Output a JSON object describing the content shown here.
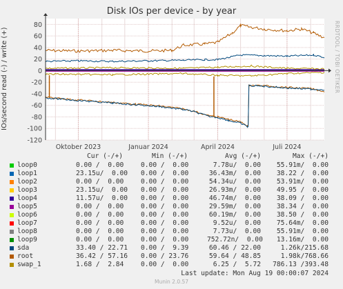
{
  "title": "Disk IOs per device - by year",
  "side_label": "RRDTOOL / TOBI OETIKER",
  "footer": {
    "last_update": "Last update: Mon Aug 19 00:00:07 2024",
    "version": "Munin 2.0.57"
  },
  "legend": {
    "headers": {
      "cur": "Cur (-/+)",
      "min": "Min (-/+)",
      "avg": "Avg (-/+)",
      "max": "Max (-/+)"
    },
    "rows": [
      {
        "name": "loop0",
        "color": "#00cc00",
        "cur": "0.00 /  0.00",
        "min": "0.00 /  0.00",
        "avg": "7.78u/  0.00",
        "max": "55.91m/  0.00"
      },
      {
        "name": "loop1",
        "color": "#0066b3",
        "cur": "23.15u/  0.00",
        "min": "0.00 /  0.00",
        "avg": "36.43m/  0.00",
        "max": "38.22 /  0.00"
      },
      {
        "name": "loop2",
        "color": "#ff8000",
        "cur": "0.00 /  0.00",
        "min": "0.00 /  0.00",
        "avg": "54.34u/  0.00",
        "max": "53.91m/  0.00"
      },
      {
        "name": "loop3",
        "color": "#ffcc00",
        "cur": "23.15u/  0.00",
        "min": "0.00 /  0.00",
        "avg": "26.93m/  0.00",
        "max": "49.95 /  0.00"
      },
      {
        "name": "loop4",
        "color": "#330099",
        "cur": "11.57u/  0.00",
        "min": "0.00 /  0.00",
        "avg": "46.74m/  0.00",
        "max": "38.09 /  0.00"
      },
      {
        "name": "loop5",
        "color": "#990099",
        "cur": "0.00 /  0.00",
        "min": "0.00 /  0.00",
        "avg": "29.59m/  0.00",
        "max": "38.34 /  0.00"
      },
      {
        "name": "loop6",
        "color": "#ccff00",
        "cur": "0.00 /  0.00",
        "min": "0.00 /  0.00",
        "avg": "60.19m/  0.00",
        "max": "38.50 /  0.00"
      },
      {
        "name": "loop7",
        "color": "#ff0000",
        "cur": "0.00 /  0.00",
        "min": "0.00 /  0.00",
        "avg": "9.52u/  0.00",
        "max": "75.64m/  0.00"
      },
      {
        "name": "loop8",
        "color": "#808080",
        "cur": "0.00 /  0.00",
        "min": "0.00 /  0.00",
        "avg": "7.73u/  0.00",
        "max": "55.91m/  0.00"
      },
      {
        "name": "loop9",
        "color": "#008f00",
        "cur": "0.00 /  0.00",
        "min": "0.00 /  0.00",
        "avg": "752.72n/  0.00",
        "max": "13.16m/  0.00"
      },
      {
        "name": "sda",
        "color": "#00487d",
        "cur": "33.40 / 22.71",
        "min": "0.00 /  9.39",
        "avg": "60.46 / 22.00",
        "max": "1.26k/215.68"
      },
      {
        "name": "root",
        "color": "#b35a00",
        "cur": "36.42 / 57.16",
        "min": "0.00 / 23.76",
        "avg": "59.64 / 48.85",
        "max": "1.98k/768.66"
      },
      {
        "name": "swap_1",
        "color": "#b38f00",
        "cur": "1.68 /  2.84",
        "min": "0.00 /  0.00",
        "avg": "6.25 /  5.72",
        "max": "786.13 /393.48"
      }
    ]
  },
  "chart_data": {
    "type": "line",
    "title": "Disk IOs per device - by year",
    "ylabel": "IOs/second read (-) / write (+)",
    "ylim": [
      -120,
      90
    ],
    "yticks": [
      80,
      60,
      40,
      20,
      0,
      -20,
      -40,
      -60,
      -80,
      -100,
      -120
    ],
    "xlim": [
      "2023-08-19",
      "2024-08-19"
    ],
    "xticks": [
      {
        "label": "Oktober 2023",
        "date": "2023-10-01"
      },
      {
        "label": "Januar 2024",
        "date": "2024-01-01"
      },
      {
        "label": "April 2024",
        "date": "2024-04-01"
      },
      {
        "label": "Juli 2024",
        "date": "2024-07-01"
      }
    ],
    "grid": true,
    "series": [
      {
        "name": "root",
        "direction": "write",
        "color": "#b35a00",
        "points": [
          [
            "2023-08-19",
            35
          ],
          [
            "2023-10-01",
            34
          ],
          [
            "2023-11-15",
            35
          ],
          [
            "2024-01-01",
            34
          ],
          [
            "2024-02-01",
            35
          ],
          [
            "2024-02-16",
            44
          ],
          [
            "2024-03-15",
            46
          ],
          [
            "2024-04-01",
            49
          ],
          [
            "2024-04-20",
            65
          ],
          [
            "2024-05-01",
            78
          ],
          [
            "2024-05-15",
            75
          ],
          [
            "2024-06-01",
            72
          ],
          [
            "2024-07-01",
            69
          ],
          [
            "2024-07-20",
            72
          ],
          [
            "2024-08-05",
            65
          ],
          [
            "2024-08-19",
            57
          ]
        ]
      },
      {
        "name": "sda",
        "direction": "write",
        "color": "#00487d",
        "points": [
          [
            "2023-08-19",
            16
          ],
          [
            "2023-10-01",
            17
          ],
          [
            "2023-11-15",
            16
          ],
          [
            "2024-01-01",
            17
          ],
          [
            "2024-02-16",
            18
          ],
          [
            "2024-03-15",
            19
          ],
          [
            "2024-04-01",
            19
          ],
          [
            "2024-05-01",
            27
          ],
          [
            "2024-06-01",
            26
          ],
          [
            "2024-07-01",
            25
          ],
          [
            "2024-08-05",
            27
          ],
          [
            "2024-08-19",
            23
          ]
        ]
      },
      {
        "name": "swap_1",
        "direction": "write",
        "color": "#b38f00",
        "points": [
          [
            "2023-08-19",
            4
          ],
          [
            "2023-11-15",
            5
          ],
          [
            "2024-02-16",
            4
          ],
          [
            "2024-04-01",
            6
          ],
          [
            "2024-05-15",
            8
          ],
          [
            "2024-07-01",
            4
          ],
          [
            "2024-08-19",
            3
          ]
        ]
      },
      {
        "name": "root",
        "direction": "read",
        "color": "#b35a00",
        "points": [
          [
            "2023-08-19",
            -46
          ],
          [
            "2023-09-15",
            -49
          ],
          [
            "2023-10-15",
            -52
          ],
          [
            "2023-11-15",
            -55
          ],
          [
            "2023-12-15",
            -58
          ],
          [
            "2024-01-15",
            -61
          ],
          [
            "2024-02-15",
            -66
          ],
          [
            "2024-03-01",
            -70
          ],
          [
            "2024-03-20",
            -78
          ],
          [
            "2024-04-01",
            -80
          ],
          [
            "2024-04-15",
            -84
          ],
          [
            "2024-05-01",
            -89
          ],
          [
            "2024-05-10",
            -95
          ],
          [
            "2024-05-12",
            -25
          ],
          [
            "2024-06-01",
            -26
          ],
          [
            "2024-07-01",
            -29
          ],
          [
            "2024-08-01",
            -31
          ],
          [
            "2024-08-19",
            -36
          ]
        ]
      },
      {
        "name": "sda",
        "direction": "read",
        "color": "#00487d",
        "points": [
          [
            "2023-08-19",
            -47
          ],
          [
            "2023-09-15",
            -50
          ],
          [
            "2023-10-15",
            -53
          ],
          [
            "2023-11-15",
            -56
          ],
          [
            "2023-12-15",
            -59
          ],
          [
            "2024-01-15",
            -62
          ],
          [
            "2024-02-15",
            -67
          ],
          [
            "2024-03-01",
            -71
          ],
          [
            "2024-03-20",
            -79
          ],
          [
            "2024-04-01",
            -81
          ],
          [
            "2024-04-15",
            -86
          ],
          [
            "2024-05-01",
            -91
          ],
          [
            "2024-05-10",
            -97
          ],
          [
            "2024-05-12",
            -26
          ],
          [
            "2024-06-01",
            -27
          ],
          [
            "2024-07-01",
            -30
          ],
          [
            "2024-08-01",
            -32
          ],
          [
            "2024-08-19",
            -33
          ]
        ]
      },
      {
        "name": "swap_1",
        "direction": "read",
        "color": "#b38f00",
        "points": [
          [
            "2023-08-19",
            -6
          ],
          [
            "2023-11-15",
            -7
          ],
          [
            "2024-02-16",
            -5
          ],
          [
            "2024-04-01",
            -8
          ],
          [
            "2024-05-15",
            -9
          ],
          [
            "2024-07-01",
            -5
          ],
          [
            "2024-08-19",
            -3
          ]
        ]
      }
    ],
    "spikes": [
      {
        "series": "root",
        "date": "2023-08-24",
        "from": -46,
        "to": -8,
        "color": "#b35a00"
      },
      {
        "series": "root",
        "date": "2024-03-27",
        "from": -80,
        "to": -10,
        "color": "#b35a00"
      }
    ]
  }
}
